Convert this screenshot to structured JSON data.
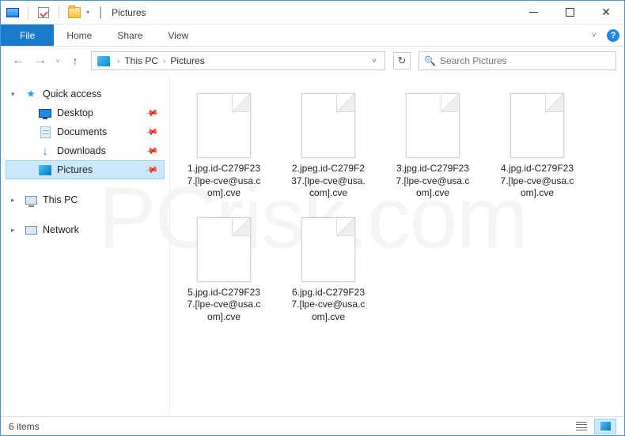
{
  "window": {
    "title": "Pictures"
  },
  "ribbon": {
    "file": "File",
    "tabs": [
      "Home",
      "Share",
      "View"
    ]
  },
  "breadcrumb": {
    "root": "This PC",
    "current": "Pictures"
  },
  "search": {
    "placeholder": "Search Pictures"
  },
  "sidebar": {
    "quick_access": "Quick access",
    "items": [
      {
        "label": "Desktop",
        "pinned": true
      },
      {
        "label": "Documents",
        "pinned": true
      },
      {
        "label": "Downloads",
        "pinned": true
      },
      {
        "label": "Pictures",
        "pinned": true,
        "selected": true
      }
    ],
    "this_pc": "This PC",
    "network": "Network"
  },
  "files": [
    {
      "name": "1.jpg.id-C279F237.[lpe-cve@usa.com].cve"
    },
    {
      "name": "2.jpeg.id-C279F237.[lpe-cve@usa.com].cve"
    },
    {
      "name": "3.jpg.id-C279F237.[lpe-cve@usa.com].cve"
    },
    {
      "name": "4.jpg.id-C279F237.[lpe-cve@usa.com].cve"
    },
    {
      "name": "5.jpg.id-C279F237.[lpe-cve@usa.com].cve"
    },
    {
      "name": "6.jpg.id-C279F237.[lpe-cve@usa.com].cve"
    }
  ],
  "status": {
    "count": "6 items"
  }
}
